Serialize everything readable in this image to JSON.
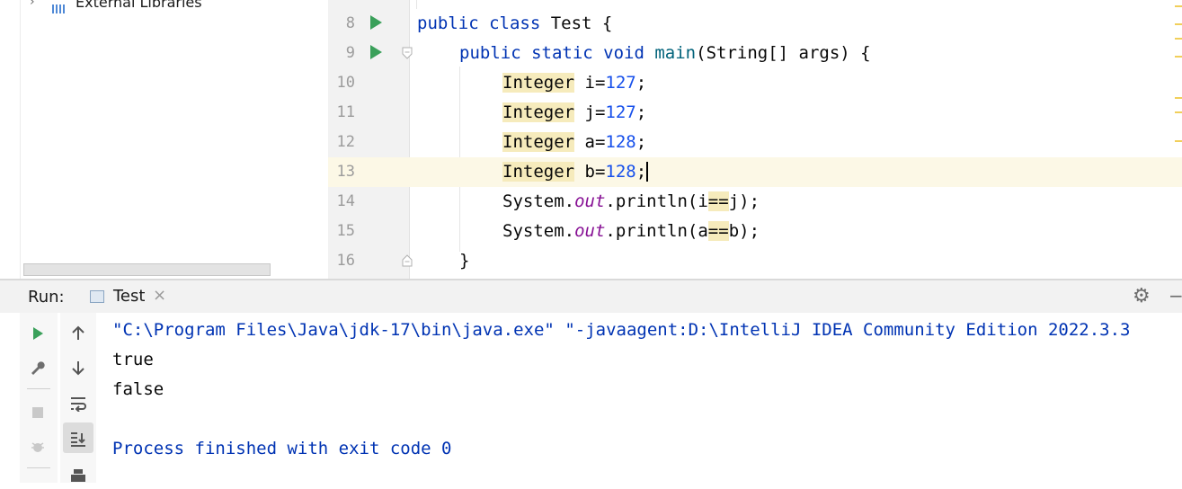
{
  "project": {
    "tree_item_label": "External Libraries",
    "chevron_icon": "chevron-right-icon",
    "library_icon": "library-icon"
  },
  "editor": {
    "current_line": 13,
    "lines": [
      {
        "num": "8",
        "runnable": true
      },
      {
        "num": "9",
        "runnable": true
      },
      {
        "num": "10"
      },
      {
        "num": "11"
      },
      {
        "num": "12"
      },
      {
        "num": "13"
      },
      {
        "num": "14"
      },
      {
        "num": "15"
      },
      {
        "num": "16"
      }
    ],
    "code": {
      "l8_kw": "public class",
      "l8_rest": " Test {",
      "l9_kw": "public static void",
      "l9_fn": "main",
      "l9_rest": "(String[] args) {",
      "l10_type": "Integer",
      "l10_var": " i=",
      "l10_num": "127",
      "l11_type": "Integer",
      "l11_var": " j=",
      "l11_num": "127",
      "l12_type": "Integer",
      "l12_var": " a=",
      "l12_num": "128",
      "l13_type": "Integer",
      "l13_var": " b=",
      "l13_num": "128",
      "l14_pre": "System.",
      "l14_field": "out",
      "l14_mid": ".println(i",
      "l14_op": "==",
      "l14_end": "j);",
      "l15_pre": "System.",
      "l15_field": "out",
      "l15_mid": ".println(a",
      "l15_op": "==",
      "l15_end": "b);",
      "l16": "}",
      "semicolon": ";"
    }
  },
  "run_panel": {
    "label": "Run:",
    "tab_label": "Test",
    "tab_close": "×",
    "gear_icon": "gear-icon",
    "minimize_glyph": "−",
    "output": [
      {
        "text": "\"C:\\Program Files\\Java\\jdk-17\\bin\\java.exe\" \"-javaagent:D:\\IntelliJ IDEA Community Edition 2022.3.3",
        "color": "#0033b3"
      },
      {
        "text": "true",
        "color": "#080808"
      },
      {
        "text": "false",
        "color": "#080808"
      },
      {
        "text": "",
        "color": "#080808"
      },
      {
        "text": "Process finished with exit code 0",
        "color": "#0033b3"
      }
    ]
  },
  "colors": {
    "keyword": "#0033b3",
    "number": "#1750eb",
    "field": "#871094",
    "run_green": "#3aa05a",
    "highlight": "#f6ebbc",
    "current_line": "#fcf8e6"
  }
}
